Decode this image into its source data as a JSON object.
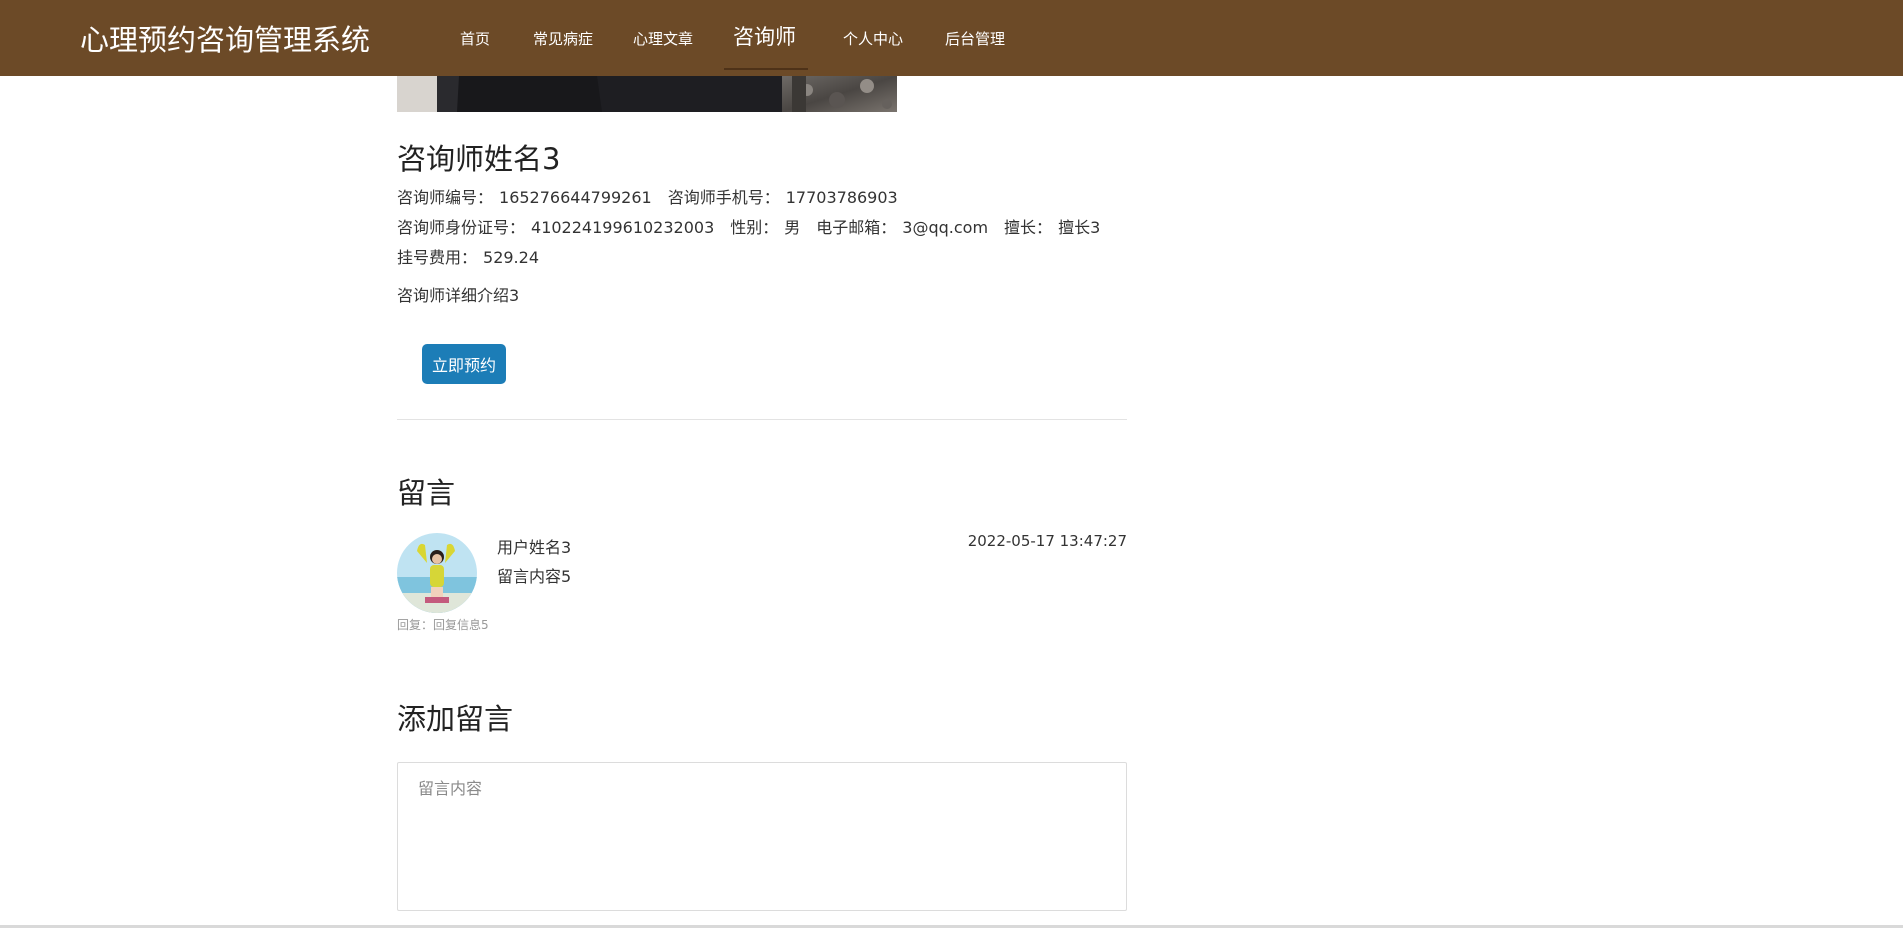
{
  "header": {
    "brand": "心理预约咨询管理系统",
    "nav": [
      {
        "label": "首页",
        "active": false
      },
      {
        "label": "常见病症",
        "active": false
      },
      {
        "label": "心理文章",
        "active": false
      },
      {
        "label": "咨询师",
        "active": true
      },
      {
        "label": "个人中心",
        "active": false
      },
      {
        "label": "后台管理",
        "active": false
      }
    ],
    "colors": {
      "bar": "#6c4a27",
      "text": "#ffffff"
    }
  },
  "counselor": {
    "name": "咨询师姓名3",
    "id_label": "咨询师编号：",
    "id_value": "165276644799261",
    "phone_label": "咨询师手机号：",
    "phone_value": "17703786903",
    "idcard_label": "咨询师身份证号：",
    "idcard_value": "410224199610232003",
    "gender_label": "性别：",
    "gender_value": "男",
    "email_label": "电子邮箱：",
    "email_value": "3@qq.com",
    "specialty_label": "擅长：",
    "specialty_value": "擅长3",
    "fee_label": "挂号费用：",
    "fee_value": "529.24",
    "intro": "咨询师详细介绍3",
    "book_button": "立即预约",
    "colors": {
      "button": "#1c7db7"
    }
  },
  "messages": {
    "title": "留言",
    "items": [
      {
        "avatar_icon": "user-avatar-photo",
        "user": "用户姓名3",
        "content": "留言内容5",
        "time": "2022-05-17 13:47:27",
        "reply": "回复：回复信息5"
      }
    ]
  },
  "add_message": {
    "title": "添加留言",
    "placeholder": "留言内容"
  }
}
